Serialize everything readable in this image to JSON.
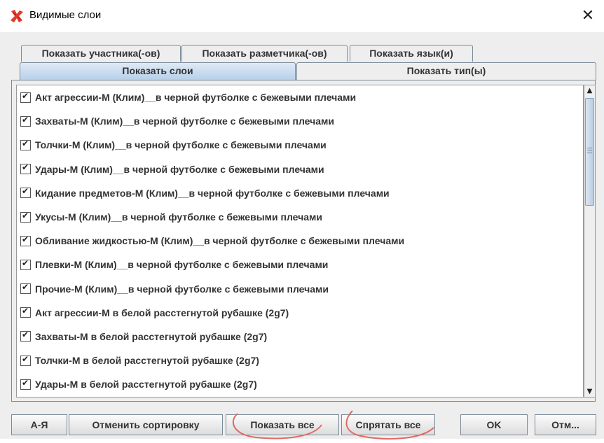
{
  "window": {
    "title": "Видимые слои",
    "close_glyph": "✕",
    "icon": "tool-x-icon",
    "accent_color": "#e2392c"
  },
  "tabs": {
    "row1": [
      {
        "label": "Показать участника(-ов)",
        "selected": false
      },
      {
        "label": "Показать разметчика(-ов)",
        "selected": false
      },
      {
        "label": "Показать язык(и)",
        "selected": false
      }
    ],
    "row2": [
      {
        "label": "Показать слои",
        "selected": true
      },
      {
        "label": "Показать тип(ы)",
        "selected": false
      }
    ]
  },
  "layers": [
    {
      "label": "Акт агрессии-М (Клим)__в черной футболке с бежевыми плечами",
      "checked": true
    },
    {
      "label": "Захваты-М (Клим)__в черной футболке с бежевыми плечами",
      "checked": true
    },
    {
      "label": "Толчки-М (Клим)__в черной футболке с бежевыми плечами",
      "checked": true
    },
    {
      "label": "Удары-М (Клим)__в черной футболке с бежевыми плечами",
      "checked": true
    },
    {
      "label": "Кидание предметов-М (Клим)__в черной футболке с бежевыми плечами",
      "checked": true
    },
    {
      "label": "Укусы-М (Клим)__в черной футболке с бежевыми плечами",
      "checked": true
    },
    {
      "label": "Обливание жидкостью-М (Клим)__в черной футболке с бежевыми плечами",
      "checked": true
    },
    {
      "label": "Плевки-М (Клим)__в черной футболке с бежевыми плечами",
      "checked": true
    },
    {
      "label": "Прочие-М (Клим)__в черной футболке с бежевыми плечами",
      "checked": true
    },
    {
      "label": "Акт агрессии-М в белой расстегнутой рубашке (2g7)",
      "checked": true
    },
    {
      "label": "Захваты-М в белой расстегнутой рубашке (2g7)",
      "checked": true
    },
    {
      "label": "Толчки-М в белой расстегнутой рубашке (2g7)",
      "checked": true
    },
    {
      "label": "Удары-М в белой расстегнутой рубашке (2g7)",
      "checked": true
    }
  ],
  "scrollbar": {
    "up_glyph": "▲",
    "down_glyph": "▼"
  },
  "buttons": {
    "sort_az": "А-Я",
    "cancel_sort": "Отменить сортировку",
    "show_all": "Показать все",
    "hide_all": "Спрятать все",
    "ok": "OK",
    "cancel": "Отм..."
  },
  "annotation_color": "#e06a66"
}
